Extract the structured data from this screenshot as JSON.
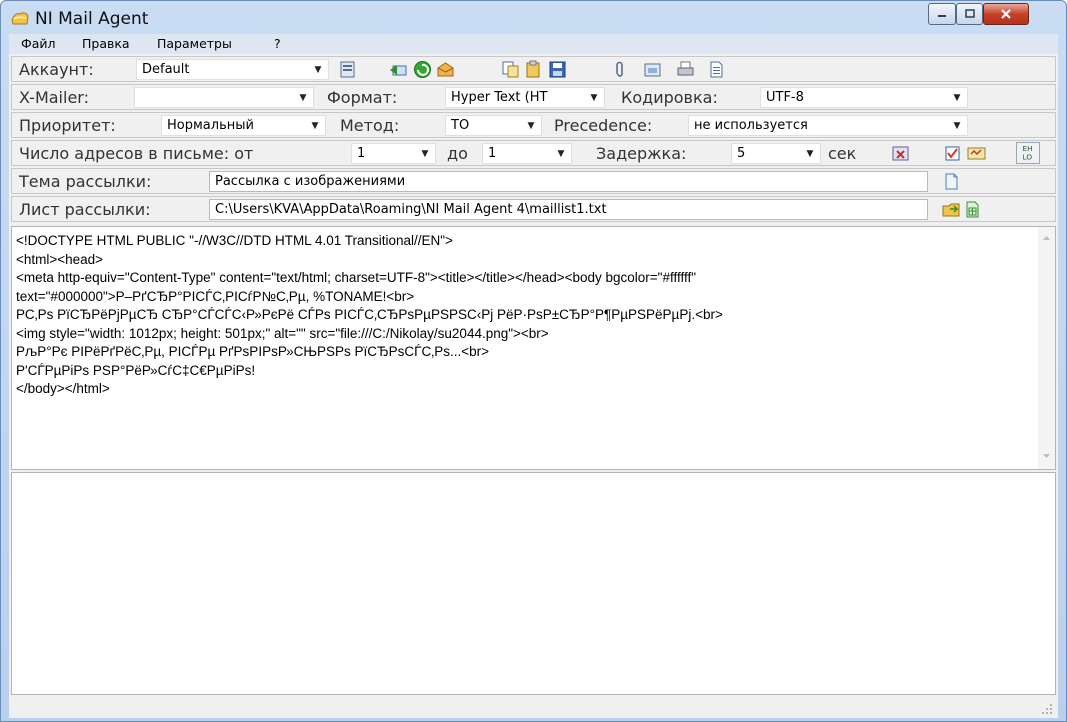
{
  "window": {
    "title": "NI Mail Agent"
  },
  "menu": {
    "items": [
      "Файл",
      "Правка",
      "Параметры",
      "?"
    ]
  },
  "account": {
    "label": "Аккаунт:",
    "value": "Default"
  },
  "options": {
    "xmailer_label": "X-Mailer:",
    "xmailer_value": "",
    "format_label": "Формат:",
    "format_value": "Hyper Text (HT",
    "encoding_label": "Кодировка:",
    "encoding_value": "UTF-8"
  },
  "priority": {
    "priority_label": "Приоритет:",
    "priority_value": "Нормальный",
    "method_label": "Метод:",
    "method_value": "TO",
    "precedence_label": "Precedence:",
    "precedence_value": "не используется"
  },
  "addresses": {
    "count_label": "Число адресов в письме: от",
    "from_value": "1",
    "to_label": "до",
    "to_value": "1",
    "delay_label": "Задержка:",
    "delay_value": "5",
    "unit_label": "сек"
  },
  "subject": {
    "label": "Тема рассылки:",
    "value": "Рассылка с изображениями"
  },
  "maillist": {
    "label": "Лист рассылки:",
    "value": "C:\\Users\\KVA\\AppData\\Roaming\\NI Mail Agent 4\\maillist1.txt"
  },
  "editor": {
    "lines": [
      "<!DOCTYPE HTML PUBLIC \"-//W3C//DTD HTML 4.01 Transitional//EN\">",
      "<html><head>",
      "<meta http-equiv=\"Content-Type\" content=\"text/html; charset=UTF-8\"><title></title></head><body bgcolor=\"#ffffff\"",
      "text=\"#000000\">Р–РґСЂР°РІСЃС‚РІСѓР№С‚Рµ, %TONAME!<br>",
      "Р­С‚Рѕ РїСЂРёРјРµСЂ СЂР°СЃСЃС‹Р»РєРё СЃРѕ РІСЃС‚СЂРѕРµРЅРЅС‹Рј РёР·РѕР±СЂР°Р¶РµРЅРёРµРј.<br>",
      "<img style=\"width: 1012px; height: 501px;\" alt=\"\" src=\"file:///C:/Nikolay/su2044.png\"><br>",
      "РљР°Рє РІРёРґРёС‚Рµ, РІСЃРµ РґРѕРІРѕР»СЊРЅРѕ РїСЂРѕСЃС‚Рѕ...<br>",
      "Р'СЃРµРіРѕ РЅР°РёР»СѓС‡С€РµРіРѕ!",
      "</body></html>"
    ]
  },
  "icons": {
    "account_toolbar": [
      "account-properties-icon",
      "send-icon",
      "receive-icon",
      "envelope-icon",
      "copy-icon",
      "paste-icon",
      "save-icon",
      "attach-icon",
      "folder-icon",
      "print-icon",
      "document-icon"
    ],
    "address_tools": [
      "remove-list-icon",
      "checkbox-icon",
      "template-icon",
      "en-lo-icon"
    ],
    "subject_tools": [
      "new-document-icon"
    ],
    "maillist_tools": [
      "open-folder-icon",
      "spreadsheet-icon"
    ]
  }
}
